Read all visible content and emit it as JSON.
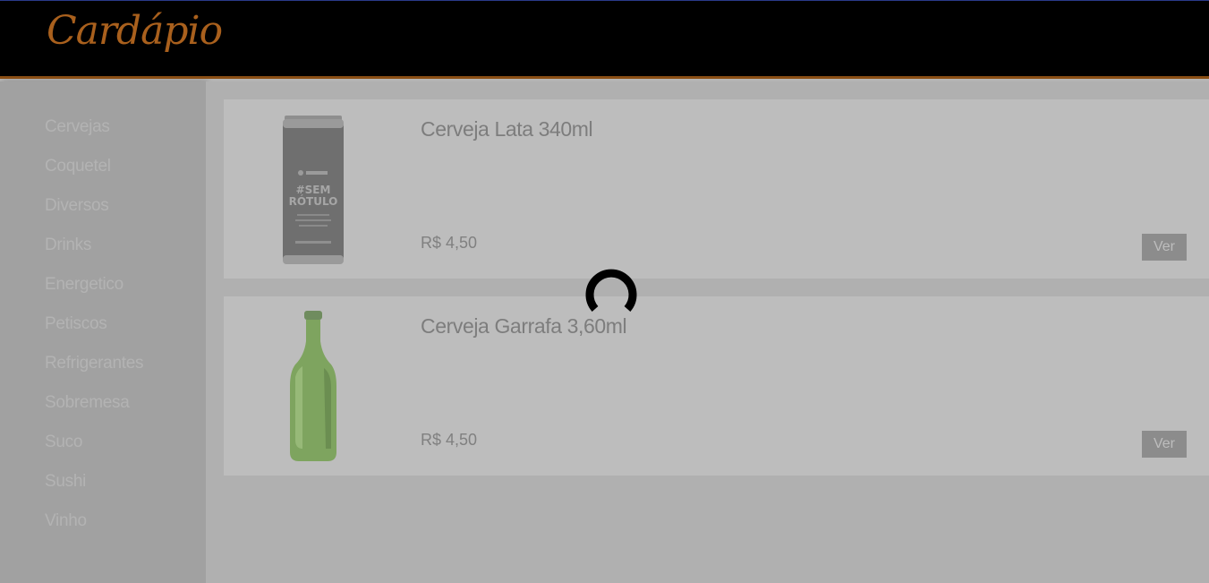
{
  "header": {
    "logo_text": "Cardápio"
  },
  "sidebar": {
    "items": [
      {
        "label": "Cervejas"
      },
      {
        "label": "Coquetel"
      },
      {
        "label": "Diversos"
      },
      {
        "label": "Drinks"
      },
      {
        "label": "Energetico"
      },
      {
        "label": "Petiscos"
      },
      {
        "label": "Refrigerantes"
      },
      {
        "label": "Sobremesa"
      },
      {
        "label": "Suco"
      },
      {
        "label": "Sushi"
      },
      {
        "label": "Vinho"
      }
    ]
  },
  "products": [
    {
      "title": "Cerveja Lata 340ml",
      "price": "R$ 4,50",
      "button_label": "Ver",
      "image_icon": "beer-can-icon",
      "can_label_line1": "#SEM",
      "can_label_line2": "RÓTULO"
    },
    {
      "title": "Cerveja Garrafa 3,60ml",
      "price": "R$ 4,50",
      "button_label": "Ver",
      "image_icon": "beer-bottle-icon"
    }
  ],
  "overlay": {
    "spinner_icon": "loading-spinner-icon"
  },
  "colors": {
    "header_bg": "#000000",
    "logo": "#a9601d",
    "header_border": "#8a4e14",
    "overlay_tint": "#b0b0b0"
  }
}
